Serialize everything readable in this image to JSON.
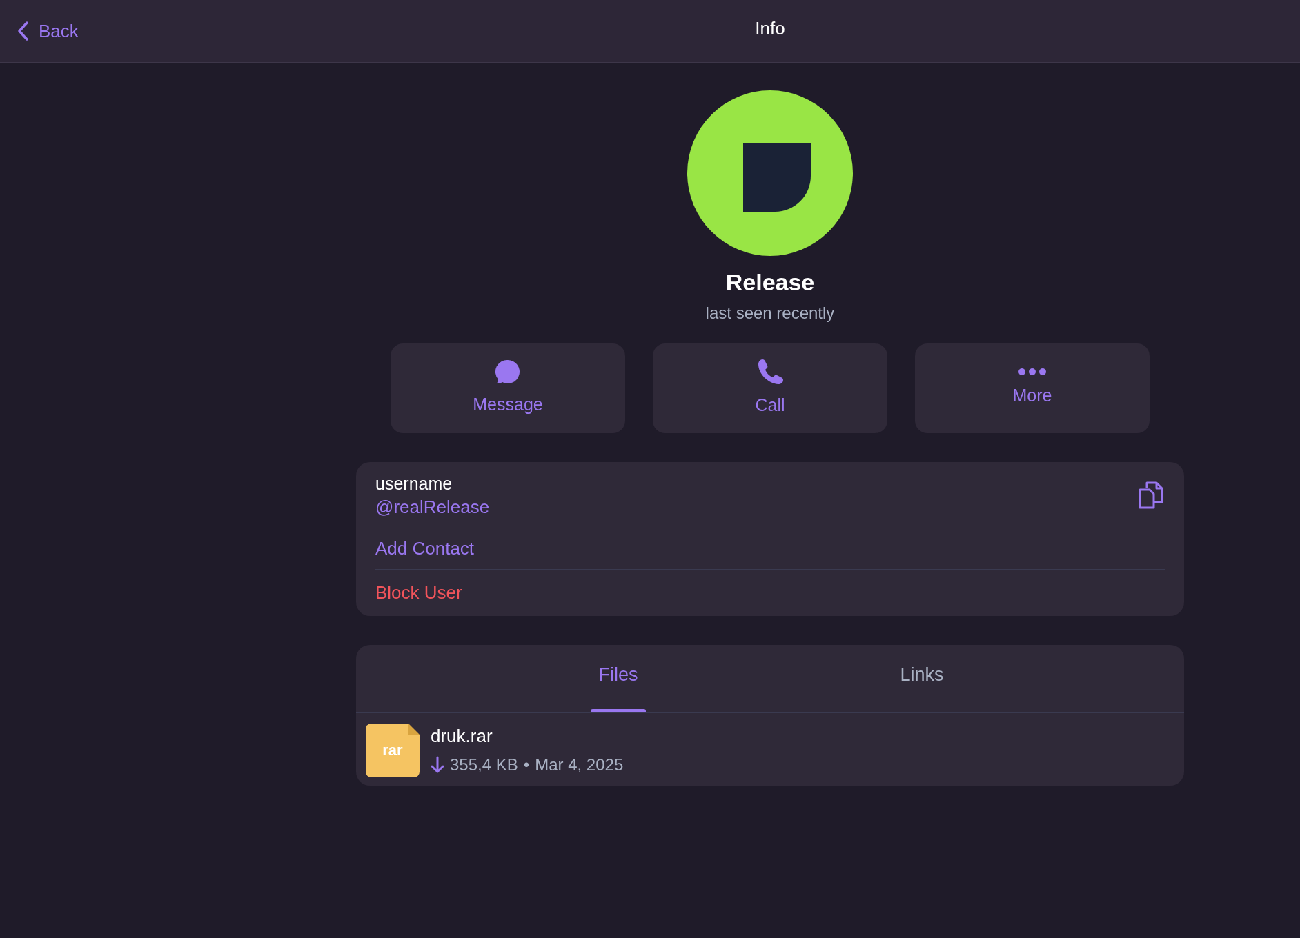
{
  "header": {
    "back": "Back",
    "title": "Info"
  },
  "profile": {
    "name": "Release",
    "status": "last seen recently"
  },
  "actions": [
    {
      "kind": "message",
      "label": "Message"
    },
    {
      "kind": "call",
      "label": "Call"
    },
    {
      "kind": "more",
      "label": "More"
    }
  ],
  "info": {
    "username_label": "username",
    "username": "@realRelease",
    "rows": [
      {
        "kind": "normal",
        "label": "Add Contact"
      },
      {
        "kind": "danger",
        "label": "Block User"
      }
    ]
  },
  "tabs": [
    {
      "label": "Files",
      "selected": true
    },
    {
      "label": "Links",
      "selected": false
    }
  ],
  "files": [
    {
      "icon_label": "rar",
      "name": "druk.rar",
      "size": "355,4 KB",
      "separator": "•",
      "date": "Mar 4, 2025"
    }
  ]
}
